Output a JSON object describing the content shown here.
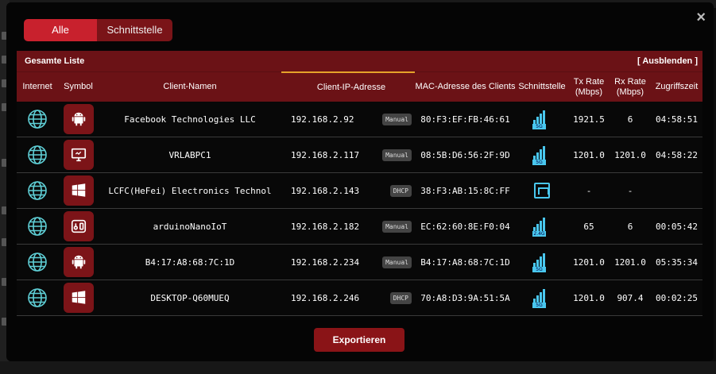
{
  "tabs": [
    {
      "label": "Alle"
    },
    {
      "label": "Schnittstelle"
    }
  ],
  "close_glyph": "×",
  "panel": {
    "title": "Gesamte Liste",
    "toggle": "[ Ausblenden ]"
  },
  "columns": [
    "Internet",
    "Symbol",
    "Client-Namen",
    "Client-IP-Adresse",
    "MAC-Adresse des Clients",
    "Schnittstelle",
    "Tx Rate (Mbps)",
    "Rx Rate (Mbps)",
    "Zugriffszeit"
  ],
  "colors": {
    "accent": "#c8212d",
    "header": "#6b1216",
    "icon_bg": "#7c1418",
    "signal": "#49c7ee",
    "sort_indicator": "#e6a32a"
  },
  "clients": [
    {
      "name": "Facebook Technologies LLC",
      "ip": "192.168.2.92",
      "ip_type": "Manual",
      "mac": "80:F3:EF:FB:46:61",
      "device_icon": "android-icon",
      "interface": "wifi-5g",
      "band": "5G",
      "tx": "1921.5",
      "rx": "6",
      "time": "04:58:51"
    },
    {
      "name": "VRLABPC1",
      "ip": "192.168.2.117",
      "ip_type": "Manual",
      "mac": "08:5B:D6:56:2F:9D",
      "device_icon": "monitor-icon",
      "interface": "wifi-5g",
      "band": "5G",
      "tx": "1201.0",
      "rx": "1201.0",
      "time": "04:58:22"
    },
    {
      "name": "LCFC(HeFei) Electronics Technol",
      "ip": "192.168.2.143",
      "ip_type": "DHCP",
      "mac": "38:F3:AB:15:8C:FF",
      "device_icon": "windows-icon",
      "interface": "wired",
      "band": "",
      "tx": "-",
      "rx": "-",
      "time": ""
    },
    {
      "name": "arduinoNanoIoT",
      "ip": "192.168.2.182",
      "ip_type": "Manual",
      "mac": "EC:62:60:8E:F0:04",
      "device_icon": "iot-device-icon",
      "interface": "wifi-2.4g",
      "band": "2.4G",
      "tx": "65",
      "rx": "6",
      "time": "00:05:42"
    },
    {
      "name": "B4:17:A8:68:7C:1D",
      "ip": "192.168.2.234",
      "ip_type": "Manual",
      "mac": "B4:17:A8:68:7C:1D",
      "device_icon": "android-icon",
      "interface": "wifi-5g",
      "band": "5G",
      "tx": "1201.0",
      "rx": "1201.0",
      "time": "05:35:34"
    },
    {
      "name": "DESKTOP-Q60MUEQ",
      "ip": "192.168.2.246",
      "ip_type": "DHCP",
      "mac": "70:A8:D3:9A:51:5A",
      "device_icon": "windows-icon",
      "interface": "wifi-5g",
      "band": "5G",
      "tx": "1201.0",
      "rx": "907.4",
      "time": "00:02:25"
    }
  ],
  "export_label": "Exportieren"
}
